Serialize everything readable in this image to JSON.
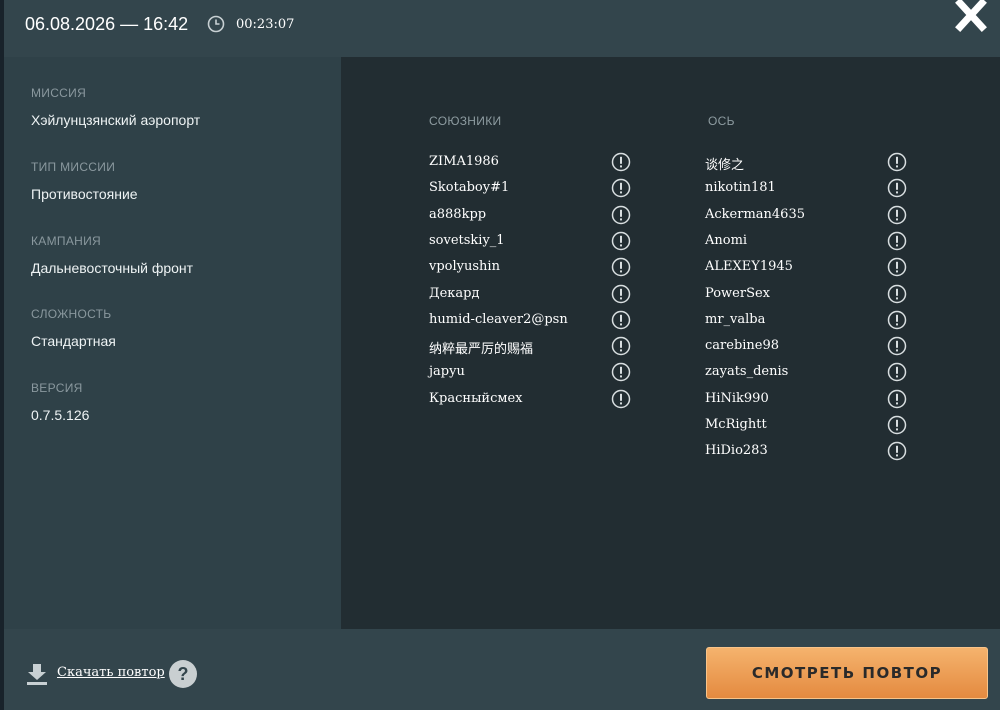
{
  "header": {
    "date_time": "06.08.2026 — 16:42",
    "duration": "00:23:07",
    "icons": {
      "clock": "clock-icon",
      "close": "close-icon"
    }
  },
  "info": {
    "mission_label": "МИССИЯ",
    "mission_value": "Хэйлунцзянский аэропорт",
    "type_label": "ТИП МИССИИ",
    "type_value": "Противостояние",
    "campaign_label": "КАМПАНИЯ",
    "campaign_value": "Дальневосточный фронт",
    "difficulty_label": "СЛОЖНОСТЬ",
    "difficulty_value": "Стандартная",
    "version_label": "ВЕРСИЯ",
    "version_value": "0.7.5.126"
  },
  "teams": {
    "allies": {
      "title": "СОЮЗНИКИ",
      "players": [
        "ZIMA1986",
        "Skotaboy#1",
        "a888kpp",
        "sovetskiy_1",
        "vpolyushin",
        "Декард",
        "humid-cleaver2@psn",
        "纳粹最严厉的赐福",
        "japyu",
        "Красныйсмех"
      ]
    },
    "axis": {
      "title": "ОСЬ",
      "players": [
        "谈修之",
        "nikotin181",
        "Ackerman4635",
        "Anomi",
        "ALEXEY1945",
        "PowerSex",
        "mr_valba",
        "carebine98",
        "zayats_denis",
        "HiNik990",
        "McRightt",
        "HiDio283"
      ]
    }
  },
  "footer": {
    "download_label": "Скачать повтор",
    "help_label": "?",
    "watch_label": "СМОТРЕТЬ ПОВТОР"
  },
  "colors": {
    "header_bg": "#33454c",
    "left_panel_bg": "#2f4148",
    "right_panel_bg": "#222d32",
    "accent_button": "#eb9a52"
  }
}
